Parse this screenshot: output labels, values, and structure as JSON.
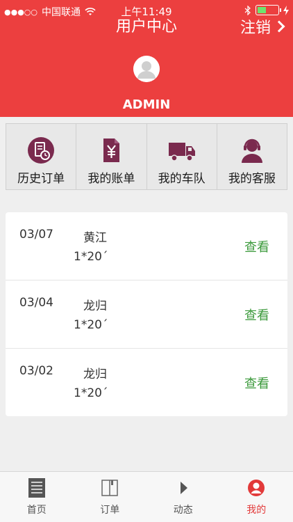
{
  "status_bar": {
    "signal": "●●●○○",
    "carrier": "中国联通",
    "time": "上午11:49"
  },
  "nav": {
    "title": "用户中心",
    "logout_label": "注销"
  },
  "profile": {
    "username": "ADMIN"
  },
  "menu": [
    {
      "label": "历史订单",
      "icon": "history-order-icon"
    },
    {
      "label": "我的账单",
      "icon": "bill-icon"
    },
    {
      "label": "我的车队",
      "icon": "truck-icon"
    },
    {
      "label": "我的客服",
      "icon": "customer-service-icon"
    }
  ],
  "orders": [
    {
      "date": "03/07",
      "place": "黄江",
      "spec": "1*20´",
      "action": "查看"
    },
    {
      "date": "03/04",
      "place": "龙归",
      "spec": "1*20´",
      "action": "查看"
    },
    {
      "date": "03/02",
      "place": "龙归",
      "spec": "1*20´",
      "action": "查看"
    }
  ],
  "tabs": [
    {
      "label": "首页",
      "icon": "home-icon"
    },
    {
      "label": "订单",
      "icon": "book-icon"
    },
    {
      "label": "动态",
      "icon": "play-icon"
    },
    {
      "label": "我的",
      "icon": "user-icon"
    }
  ],
  "colors": {
    "header": "#ec3f3f",
    "menu_icon": "#7a2a4e",
    "view_link": "#3c9a3c",
    "active_tab": "#e23a3a"
  }
}
